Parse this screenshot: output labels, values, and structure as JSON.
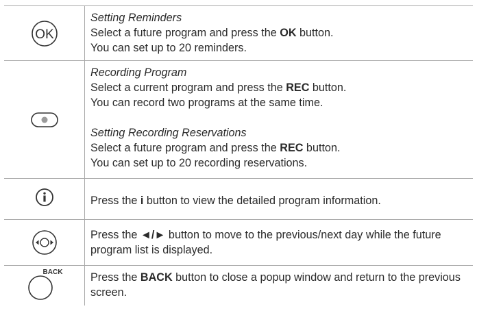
{
  "rows": [
    {
      "icon": "ok-button-icon",
      "blocks": [
        {
          "title": "Setting Reminders",
          "line1": {
            "pre": "Select a future program and press the ",
            "bold": "OK",
            "post": " button."
          },
          "line2": "You can set up to 20 reminders."
        }
      ]
    },
    {
      "icon": "rec-button-icon",
      "blocks": [
        {
          "title": "Recording Program",
          "line1": {
            "pre": "Select a current program and press the ",
            "bold": "REC",
            "post": " button."
          },
          "line2": "You can record two programs at the same time."
        },
        {
          "title": "Setting Recording Reservations",
          "line1": {
            "pre": "Select a future program and press the ",
            "bold": "REC",
            "post": " button."
          },
          "line2": "You can set up to 20 recording reservations."
        }
      ]
    },
    {
      "icon": "info-button-icon",
      "text": {
        "pre": "Press the ",
        "bold": "i",
        "post": " button to view the detailed program information."
      }
    },
    {
      "icon": "left-right-button-icon",
      "text": {
        "pre": "Press the ",
        "bold": "◄/►",
        "post": " button to move to the previous/next day while the future program list is displayed."
      }
    },
    {
      "icon": "back-button-icon",
      "icon_label": "BACK",
      "text": {
        "pre": "Press the ",
        "bold": "BACK",
        "post": " button to close a popup window and return to the previous screen."
      }
    }
  ],
  "icons": {
    "ok_label": "OK"
  }
}
